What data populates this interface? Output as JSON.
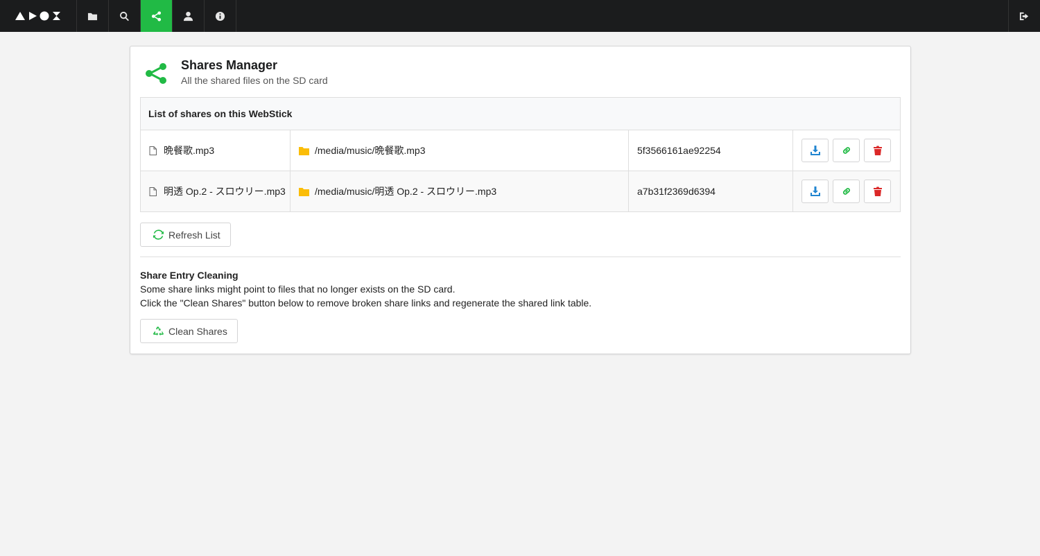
{
  "nav": {
    "logo_alt": "ArozOS",
    "items": [
      {
        "name": "files",
        "icon": "folder-icon"
      },
      {
        "name": "search",
        "icon": "search-icon"
      },
      {
        "name": "shares",
        "icon": "share-icon",
        "active": true
      },
      {
        "name": "user",
        "icon": "user-icon"
      },
      {
        "name": "info",
        "icon": "info-icon"
      }
    ],
    "logout_icon": "sign-out-icon"
  },
  "page": {
    "title": "Shares Manager",
    "subtitle": "All the shared files on the SD card"
  },
  "table": {
    "header": "List of shares on this WebStick",
    "rows": [
      {
        "filename": "晩餐歌.mp3",
        "path": "/media/music/晩餐歌.mp3",
        "share_id": "5f3566161ae92254"
      },
      {
        "filename": "明透 Op.2 - スロウリー.mp3",
        "path": "/media/music/明透 Op.2 - スロウリー.mp3",
        "share_id": "a7b31f2369d6394"
      }
    ]
  },
  "buttons": {
    "refresh": "Refresh List",
    "clean": "Clean Shares"
  },
  "cleaning": {
    "title": "Share Entry Cleaning",
    "line1": "Some share links might point to files that no longer exists on the SD card.",
    "line2": "Click the \"Clean Shares\" button below to remove broken share links and regenerate the shared link table."
  },
  "colors": {
    "topbar": "#1b1c1d",
    "accent_green": "#21ba45",
    "download_blue": "#2185d0",
    "delete_red": "#db2828",
    "folder_yellow": "#fbbd08"
  }
}
